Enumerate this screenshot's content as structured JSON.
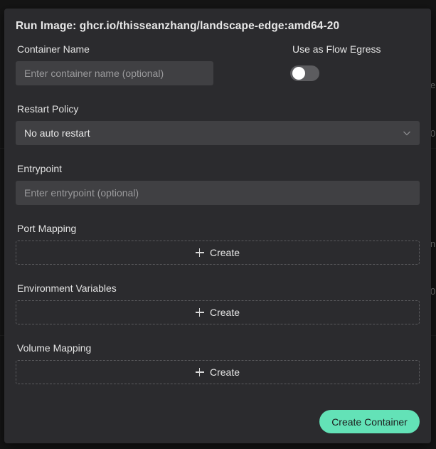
{
  "modal": {
    "title": "Run Image: ghcr.io/thisseanzhang/landscape-edge:amd64-20",
    "container_name": {
      "label": "Container Name",
      "placeholder": "Enter container name (optional)",
      "value": ""
    },
    "flow_egress": {
      "label": "Use as Flow Egress",
      "enabled": false
    },
    "restart_policy": {
      "label": "Restart Policy",
      "selected": "No auto restart"
    },
    "entrypoint": {
      "label": "Entrypoint",
      "placeholder": "Enter entrypoint (optional)",
      "value": ""
    },
    "port_mapping": {
      "label": "Port Mapping",
      "create_label": "Create"
    },
    "env_vars": {
      "label": "Environment Variables",
      "create_label": "Create"
    },
    "volume_mapping": {
      "label": "Volume Mapping",
      "create_label": "Create"
    },
    "submit_label": "Create Container"
  },
  "background_peek": {
    "row1": "e",
    "row2": "0",
    "row3": "n",
    "row4": "0"
  },
  "colors": {
    "accent": "#63e2b7",
    "modal_bg": "#2b2b2e",
    "input_bg": "#404043"
  }
}
